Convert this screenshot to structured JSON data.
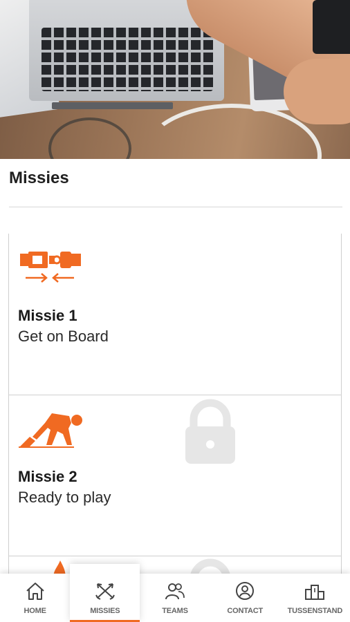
{
  "colors": {
    "accent": "#f06a22",
    "lock": "#e6e6e6",
    "text": "#1a1a1a"
  },
  "page": {
    "title": "Missies"
  },
  "missions": [
    {
      "heading": "Missie 1",
      "subtitle": "Get on Board",
      "icon": "seatbelt-icon",
      "locked": false
    },
    {
      "heading": "Missie 2",
      "subtitle": "Ready to play",
      "icon": "runner-start-icon",
      "locked": true
    },
    {
      "icon": "flame-icon",
      "locked": true
    }
  ],
  "nav": {
    "items": [
      {
        "label": "HOME",
        "icon": "home-icon",
        "active": false
      },
      {
        "label": "MISSIES",
        "icon": "crossed-arrows-icon",
        "active": true
      },
      {
        "label": "TEAMS",
        "icon": "team-icon",
        "active": false
      },
      {
        "label": "CONTACT",
        "icon": "contact-icon",
        "active": false
      },
      {
        "label": "TUSSENSTAND",
        "icon": "podium-icon",
        "active": false
      }
    ]
  }
}
